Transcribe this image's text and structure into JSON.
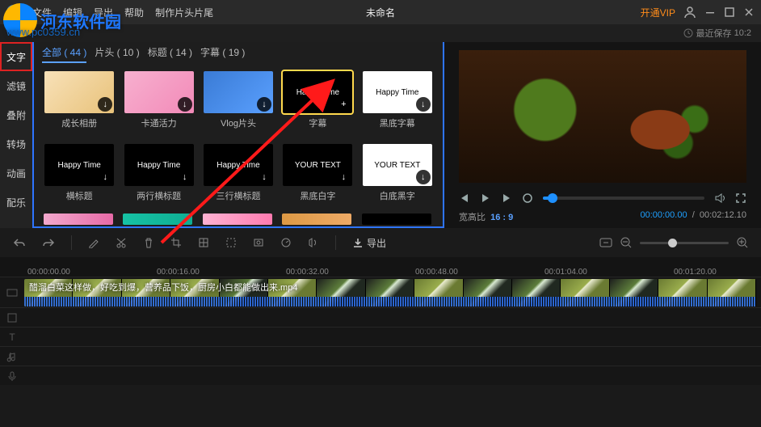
{
  "menu": {
    "items": [
      "文件",
      "编辑",
      "导出",
      "帮助",
      "制作片头片尾"
    ],
    "title": "未命名",
    "vip": "开通VIP",
    "autosave_label": "最近保存",
    "autosave_time": "10:2"
  },
  "watermark": {
    "text": "河东软件园",
    "url": "www.pc0359.cn"
  },
  "side_tabs": [
    "文字",
    "滤镜",
    "叠附",
    "转场",
    "动画",
    "配乐"
  ],
  "asset_tabs": [
    {
      "label": "全部",
      "count": 44,
      "active": true
    },
    {
      "label": "片头",
      "count": 10
    },
    {
      "label": "标题",
      "count": 14
    },
    {
      "label": "字幕",
      "count": 19
    }
  ],
  "assets": [
    {
      "label": "成长相册",
      "bg": "linear-gradient(135deg,#f8e1b8,#e8c27a)",
      "txt": ""
    },
    {
      "label": "卡通活力",
      "bg": "linear-gradient(135deg,#f7b0cf,#f28ab8)",
      "txt": ""
    },
    {
      "label": "Vlog片头",
      "bg": "linear-gradient(135deg,#3a7bd5,#5aa0ff)",
      "txt": ""
    },
    {
      "label": "字幕",
      "bg": "#000",
      "txt": "Happy Time",
      "selected": true,
      "plus": true
    },
    {
      "label": "黑底字幕",
      "bg": "#fff",
      "txt": "Happy Time",
      "dark": true
    },
    {
      "label": "横标题",
      "bg": "#000",
      "txt": "Happy Time"
    },
    {
      "label": "两行横标题",
      "bg": "#000",
      "txt": "Happy Time"
    },
    {
      "label": "三行横标题",
      "bg": "#000",
      "txt": "Happy Time"
    },
    {
      "label": "黑底白字",
      "bg": "#000",
      "txt": "YOUR TEXT"
    },
    {
      "label": "白底黑字",
      "bg": "#fff",
      "txt": "YOUR TEXT",
      "dark": true
    }
  ],
  "asset_peeks": [
    "linear-gradient(90deg,#f2a8cc,#e76aa7)",
    "linear-gradient(90deg,#16c2a5,#0fae93)",
    "linear-gradient(90deg,#ffb2d2,#ff7bb0)",
    "linear-gradient(90deg,#d94,#ea6)",
    "#000"
  ],
  "preview": {
    "ratio_label": "宽高比",
    "ratio": "16 : 9",
    "current": "00:00:00.00",
    "total": "00:02:12.10"
  },
  "toolbar": {
    "export": "导出"
  },
  "ruler": [
    "00:00:00.00",
    "00:00:16.00",
    "00:00:32.00",
    "00:00:48.00",
    "00:01:04.00",
    "00:01:20.00"
  ],
  "clip": {
    "label": "醋溜白菜这样做，好吃到爆，营养品下饭，厨房小白都能做出来.mp4"
  }
}
